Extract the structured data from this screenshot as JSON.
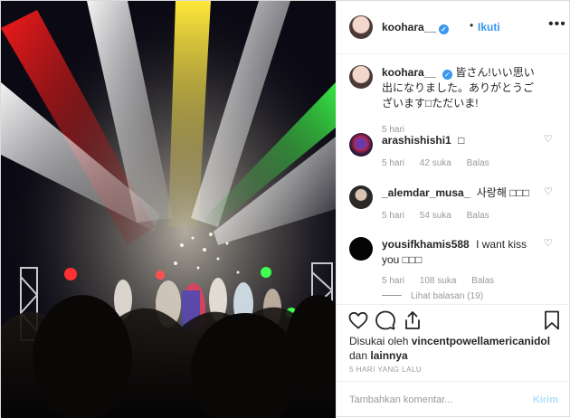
{
  "header": {
    "username": "koohara__",
    "verified_mark": "✓",
    "separator": "•",
    "follow_label": "Ikuti",
    "more_icon": "more-horizontal-icon"
  },
  "caption": {
    "username": "koohara__",
    "text": "皆さん!いい思い出になりました。ありがとうございます□ただいま!",
    "time": "5 hari"
  },
  "comments": [
    {
      "username": "arashishishi1",
      "text": "□",
      "time": "5 hari",
      "likes": "42 suka",
      "reply": "Balas"
    },
    {
      "username": "_alemdar_musa_",
      "text": "사랑해 □□□",
      "time": "5 hari",
      "likes": "54 suka",
      "reply": "Balas"
    },
    {
      "username": "yousifkhamis588",
      "text": "I want kiss you □□□",
      "time": "5 hari",
      "likes": "108 suka",
      "reply": "Balas",
      "view_replies": "Lihat balasan (19)"
    }
  ],
  "likes_line": {
    "prefix": "Disukai oleh",
    "user": "vincentpowellamericanidol",
    "middle": "dan",
    "suffix": "lainnya"
  },
  "post_date": "5 HARI YANG LALU",
  "add_comment": {
    "placeholder": "Tambahkan komentar...",
    "send_label": "Kirim"
  },
  "colors": {
    "accent": "#3897f0",
    "muted": "#999999",
    "border": "#efefef"
  }
}
